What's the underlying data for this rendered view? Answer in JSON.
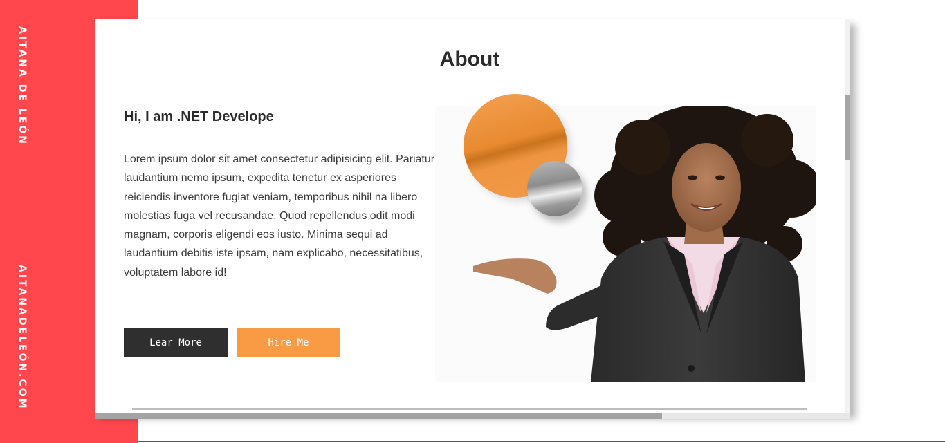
{
  "sidebar": {
    "name": "AITANA DE LEÓN",
    "website": "AITANADELEÓN.COM"
  },
  "about": {
    "title": "About",
    "headline": "Hi, I am .NET Develope",
    "bio": "Lorem ipsum dolor sit amet consectetur adipisicing elit. Pariatur laudantium nemo ipsum, expedita tenetur ex asperiores reiciendis inventore fugiat veniam, temporibus nihil na libero molestias fuga vel recusandae. Quod repellendus odit modi magnam, corporis eligendi eos iusto. Minima sequi ad laudantium debitis iste ipsam, nam explicabo, necessitatibus, voluptatem labore id!",
    "learn_more_label": "Lear More",
    "hire_me_label": "Hire Me"
  },
  "colors": {
    "accent_red": "#ff474d",
    "button_dark": "#2f2f2f",
    "button_orange": "#f99b45",
    "circle_orange": "#e88a30",
    "circle_grey": "#9a9a9a"
  },
  "icons": {
    "photo": "portrait-photo-woman-presenting",
    "decorations": [
      "orange-circle",
      "grey-circle"
    ]
  },
  "scroll": {
    "vertical_position": 0.19,
    "horizontal_visible_fraction": 0.75
  }
}
